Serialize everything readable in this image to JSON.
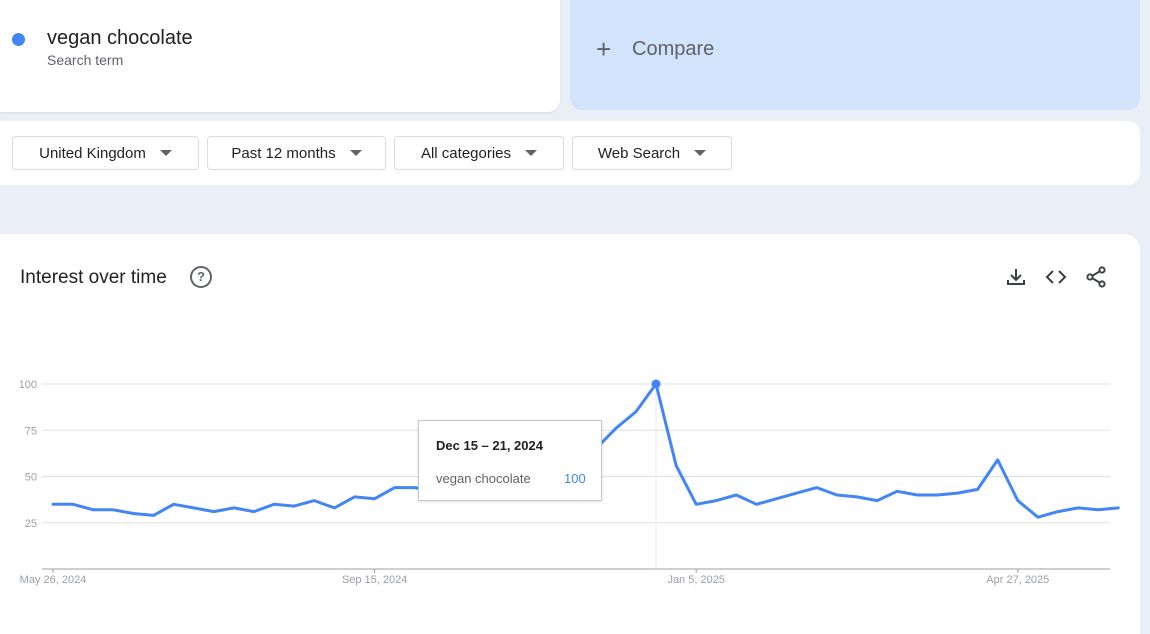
{
  "search_term": {
    "name": "vegan chocolate",
    "subtitle": "Search term",
    "color": "#4285f4"
  },
  "compare": {
    "icon": "plus-icon",
    "label": "Compare"
  },
  "filters": [
    {
      "label": "United Kingdom"
    },
    {
      "label": "Past 12 months"
    },
    {
      "label": "All categories"
    },
    {
      "label": "Web Search"
    }
  ],
  "panel": {
    "title": "Interest over time",
    "help_icon": "help-icon",
    "actions": [
      "download-icon",
      "embed-code-icon",
      "share-icon"
    ]
  },
  "tooltip": {
    "date": "Dec 15 – 21, 2024",
    "series": "vegan chocolate",
    "value": "100"
  },
  "chart_data": {
    "type": "line",
    "title": "Interest over time",
    "xlabel": "",
    "ylabel": "",
    "ylim": [
      0,
      100
    ],
    "yticks": [
      "25",
      "50",
      "75",
      "100"
    ],
    "xticks": [
      "May 26, 2024",
      "Sep 15, 2024",
      "Jan 5, 2025",
      "Apr 27, 2025"
    ],
    "grid": true,
    "series": [
      {
        "color": "#4285f4",
        "values": [
          35,
          35,
          32,
          32,
          30,
          29,
          35,
          33,
          31,
          33,
          31,
          35,
          34,
          37,
          33,
          39,
          38,
          44,
          44,
          42,
          40,
          40,
          43,
          47,
          53,
          57,
          60,
          65,
          76,
          85,
          100,
          56,
          35,
          37,
          40,
          35,
          38,
          41,
          44,
          40,
          39,
          37,
          42,
          40,
          40,
          41,
          43,
          59,
          37,
          28,
          31,
          33,
          32,
          33
        ]
      }
    ],
    "highlight_index": 30
  }
}
